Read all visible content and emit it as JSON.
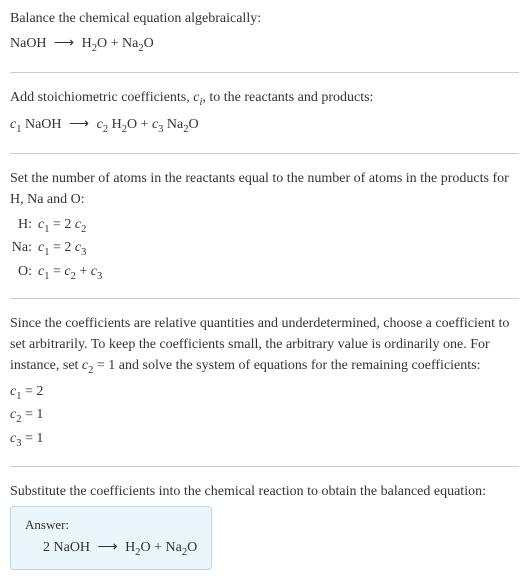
{
  "section1": {
    "title": "Balance the chemical equation algebraically:",
    "equation": "NaOH ⟶ H₂O + Na₂O"
  },
  "section2": {
    "title_before": "Add stoichiometric coefficients, ",
    "title_var": "c",
    "title_sub": "i",
    "title_after": ", to the reactants and products:",
    "eq_c1": "c",
    "eq_c1_sub": "1",
    "eq_r1": " NaOH ",
    "eq_arrow": "⟶",
    "eq_c2": " c",
    "eq_c2_sub": "2",
    "eq_p1": " H",
    "eq_p1_sub": "2",
    "eq_p1b": "O + ",
    "eq_c3": "c",
    "eq_c3_sub": "3",
    "eq_p2": " Na",
    "eq_p2_sub": "2",
    "eq_p2b": "O"
  },
  "section3": {
    "title": "Set the number of atoms in the reactants equal to the number of atoms in the products for H, Na and O:",
    "rows": [
      {
        "label": "H:",
        "lhs_c": "c",
        "lhs_sub": "1",
        "eq": " = 2 ",
        "rhs_c": "c",
        "rhs_sub": "2",
        "tail": ""
      },
      {
        "label": "Na:",
        "lhs_c": "c",
        "lhs_sub": "1",
        "eq": " = 2 ",
        "rhs_c": "c",
        "rhs_sub": "3",
        "tail": ""
      },
      {
        "label": "O:",
        "lhs_c": "c",
        "lhs_sub": "1",
        "eq": " = ",
        "rhs_c": "c",
        "rhs_sub": "2",
        "tail_plus": " + ",
        "rhs2_c": "c",
        "rhs2_sub": "3"
      }
    ]
  },
  "section4": {
    "text_a": "Since the coefficients are relative quantities and underdetermined, choose a coefficient to set arbitrarily. To keep the coefficients small, the arbitrary value is ordinarily one. For instance, set ",
    "set_c": "c",
    "set_sub": "2",
    "set_val": " = 1",
    "text_b": " and solve the system of equations for the remaining coefficients:",
    "coefs": [
      {
        "c": "c",
        "sub": "1",
        "val": " = 2"
      },
      {
        "c": "c",
        "sub": "2",
        "val": " = 1"
      },
      {
        "c": "c",
        "sub": "3",
        "val": " = 1"
      }
    ]
  },
  "section5": {
    "title": "Substitute the coefficients into the chemical reaction to obtain the balanced equation:",
    "answer_label": "Answer:",
    "answer_eq": "2 NaOH ⟶ H₂O + Na₂O"
  },
  "chart_data": {
    "type": "table",
    "title": "Balanced chemical equation coefficients",
    "reaction_unbalanced": "NaOH ⟶ H2O + Na2O",
    "reaction_balanced": "2 NaOH ⟶ H2O + Na2O",
    "atom_balance": [
      {
        "element": "H",
        "equation": "c1 = 2 c2"
      },
      {
        "element": "Na",
        "equation": "c1 = 2 c3"
      },
      {
        "element": "O",
        "equation": "c1 = c2 + c3"
      }
    ],
    "coefficients": {
      "c1": 2,
      "c2": 1,
      "c3": 1
    }
  }
}
